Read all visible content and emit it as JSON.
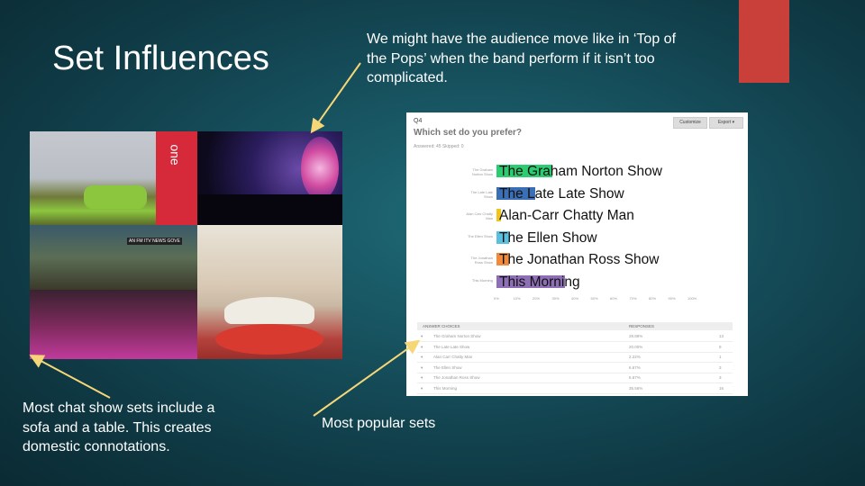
{
  "slide": {
    "title": "Set Influences",
    "note_top": "We might have the audience move like in ‘Top of the Pops’ when the band perform if it isn’t too complicated.",
    "note_bottom_left": "Most chat show sets include a sofa and a table. This creates domestic connotations.",
    "note_bottom_center": "Most popular sets",
    "accent_color": "#c9403a"
  },
  "collage": {
    "label_one": "one",
    "label_news": "AN FM  ITV NEWS  GOVE"
  },
  "survey": {
    "question_number": "Q4",
    "question": "Which set do you prefer?",
    "meta": "Answered: 45    Skipped: 0",
    "button_customize": "Customize",
    "button_export": "Export ▾",
    "options": [
      {
        "label": "The Graham Norton Show",
        "short": "The Graham Norton Show",
        "percent": 28.89,
        "color": "#2ecc71"
      },
      {
        "label": "The Late Late Show",
        "short": "The Late Late Show",
        "percent": 20.0,
        "color": "#3a6fb5"
      },
      {
        "label": "Alan-Carr Chatty Man",
        "short": "Alan Carr Chatty Man",
        "percent": 2.22,
        "color": "#f0c419"
      },
      {
        "label": "The Ellen Show",
        "short": "The Ellen Show",
        "percent": 6.67,
        "color": "#5bc0de"
      },
      {
        "label": "The Jonathan Ross Show",
        "short": "The Jonathan Ross Show",
        "percent": 6.67,
        "color": "#f08a3c"
      },
      {
        "label": "This Morning",
        "short": "This Morning",
        "percent": 35.56,
        "color": "#8e6fb5"
      }
    ],
    "axis_ticks": [
      "0%",
      "10%",
      "20%",
      "30%",
      "40%",
      "50%",
      "60%",
      "70%",
      "80%",
      "90%",
      "100%"
    ],
    "table": {
      "col_choices": "ANSWER CHOICES",
      "col_responses": "RESPONSES",
      "rows": [
        {
          "choice": "The Graham Norton Show",
          "percent": "28.89%",
          "count": "13"
        },
        {
          "choice": "The Late Late Show",
          "percent": "20.00%",
          "count": "9"
        },
        {
          "choice": "Alan Carr Chatty Man",
          "percent": "2.22%",
          "count": "1"
        },
        {
          "choice": "The Ellen Show",
          "percent": "6.67%",
          "count": "3"
        },
        {
          "choice": "The Jonathan Ross Show",
          "percent": "6.67%",
          "count": "3"
        },
        {
          "choice": "This Morning",
          "percent": "35.56%",
          "count": "16"
        }
      ]
    }
  }
}
